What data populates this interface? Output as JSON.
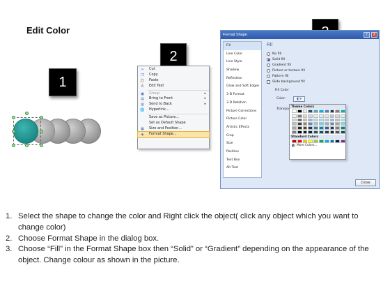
{
  "title": "Edit Color",
  "badges": [
    "1",
    "2",
    "3"
  ],
  "context_menu": {
    "items": [
      {
        "label": "Cut",
        "icon": "cut-icon",
        "glyph": "✂",
        "disabled": false
      },
      {
        "label": "Copy",
        "icon": "copy-icon",
        "glyph": "❐",
        "disabled": false
      },
      {
        "label": "Paste",
        "icon": "paste-icon",
        "glyph": "📋",
        "disabled": false
      },
      {
        "label": "Edit Text",
        "icon": "edit-text-icon",
        "glyph": "A",
        "disabled": false
      },
      {
        "label": "Group",
        "icon": "group-icon",
        "glyph": "▣",
        "disabled": true,
        "submenu": true
      },
      {
        "label": "Bring to Front",
        "icon": "bring-front-icon",
        "glyph": "▤",
        "disabled": false,
        "submenu": true
      },
      {
        "label": "Send to Back",
        "icon": "send-back-icon",
        "glyph": "▥",
        "disabled": false,
        "submenu": true
      },
      {
        "label": "Hyperlink...",
        "icon": "hyperlink-icon",
        "glyph": "🌐",
        "disabled": false
      },
      {
        "label": "Save as Picture...",
        "icon": "",
        "glyph": "",
        "disabled": false
      },
      {
        "label": "Set as Default Shape",
        "icon": "",
        "glyph": "",
        "disabled": false
      },
      {
        "label": "Size and Position...",
        "icon": "size-icon",
        "glyph": "▦",
        "disabled": false
      },
      {
        "label": "Format Shape...",
        "icon": "format-shape-icon",
        "glyph": "◈",
        "disabled": false,
        "highlighted": true
      }
    ]
  },
  "dialog": {
    "title": "Format Shape",
    "help_label": "?",
    "close_label": "X",
    "nav": [
      "Fill",
      "Line Color",
      "Line Style",
      "Shadow",
      "Reflection",
      "Glow and Soft Edges",
      "3-D Format",
      "3-D Rotation",
      "Picture Corrections",
      "Picture Color",
      "Artistic Effects",
      "Crop",
      "Size",
      "Position",
      "Text Box",
      "Alt Text"
    ],
    "active_nav": "Fill",
    "fill_heading": "Fill",
    "fill_options": [
      {
        "label": "No fill",
        "type": "radio",
        "selected": false
      },
      {
        "label": "Solid fill",
        "type": "radio",
        "selected": true
      },
      {
        "label": "Gradient fill",
        "type": "radio",
        "selected": false
      },
      {
        "label": "Picture or texture fill",
        "type": "radio",
        "selected": false
      },
      {
        "label": "Pattern fill",
        "type": "radio",
        "selected": false
      },
      {
        "label": "Slide background fill",
        "type": "checkbox",
        "selected": false
      }
    ],
    "fill_color_label": "Fill Color",
    "color_label": "Color:",
    "transparency_label": "Transpa",
    "close_button": "Close"
  },
  "palette": {
    "theme_heading": "Theme Colors",
    "theme_top": [
      "#ffffff",
      "#000000",
      "#eeece1",
      "#1f497d",
      "#4bacc6",
      "#00b0f0",
      "#4f81bd",
      "#17375e",
      "#7f7f7f",
      "#00b0b8"
    ],
    "theme_rows": [
      [
        "#f2f2f2",
        "#7f7f7f",
        "#ddd9c3",
        "#c6d9f0",
        "#daeef3",
        "#ccf2ff",
        "#dbe5f1",
        "#b7c9e2",
        "#d8d8d8",
        "#ccf7f8"
      ],
      [
        "#d8d8d8",
        "#595959",
        "#c4bd97",
        "#8db3e2",
        "#b7dde8",
        "#99e5ff",
        "#b8cce4",
        "#8db3e2",
        "#bfbfbf",
        "#99eff1"
      ],
      [
        "#bfbfbf",
        "#3f3f3f",
        "#938953",
        "#548dd4",
        "#92cddc",
        "#66d8ff",
        "#95b3d7",
        "#558ed5",
        "#a5a5a5",
        "#66e7ea"
      ],
      [
        "#a5a5a5",
        "#262626",
        "#494429",
        "#17365d",
        "#31859b",
        "#0084b4",
        "#366092",
        "#17375e",
        "#7f7f7f",
        "#00848a"
      ],
      [
        "#7f7f7f",
        "#0c0c0c",
        "#1d1b10",
        "#0f243e",
        "#215867",
        "#00587a",
        "#244061",
        "#0f243e",
        "#595959",
        "#00585c"
      ]
    ],
    "standard_heading": "Standard Colors",
    "standard": [
      "#c00000",
      "#ff0000",
      "#ffc000",
      "#ffff00",
      "#92d050",
      "#00b050",
      "#00b0f0",
      "#0070c0",
      "#002060",
      "#7030a0"
    ],
    "more_label": "More Colors..."
  },
  "shape_colors": {
    "selected": "#1b8a86",
    "others": "#9a9a9a"
  },
  "steps": [
    {
      "num": "1.",
      "text": "Select the shape to change the color and Right click the object( click any object which you want to change color)"
    },
    {
      "num": "2.",
      "text": "Choose Format Shape in the dialog box."
    },
    {
      "num": "3.",
      "text": "Choose “Fill” in the Format Shape box then “Solid” or “Gradient” depending on the appearance of the object. Change colour as shown in the picture."
    }
  ]
}
